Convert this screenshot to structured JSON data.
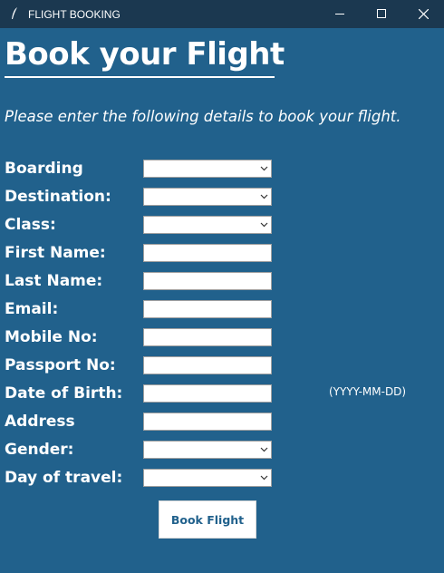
{
  "window": {
    "title": "FLIGHT BOOKING",
    "controls": {
      "minimize": "minimize-icon",
      "maximize": "maximize-icon",
      "close": "close-icon"
    }
  },
  "heading": "Book your Flight",
  "subtitle": "Please enter the following details to book your flight.",
  "form": {
    "boarding": {
      "label": "Boarding",
      "type": "dropdown",
      "value": ""
    },
    "destination": {
      "label": "Destination:",
      "type": "dropdown",
      "value": ""
    },
    "class": {
      "label": "Class:",
      "type": "dropdown",
      "value": ""
    },
    "first_name": {
      "label": "First Name:",
      "type": "text",
      "value": ""
    },
    "last_name": {
      "label": "Last Name:",
      "type": "text",
      "value": ""
    },
    "email": {
      "label": "Email:",
      "type": "text",
      "value": ""
    },
    "mobile": {
      "label": "Mobile No:",
      "type": "text",
      "value": ""
    },
    "passport": {
      "label": "Passport No:",
      "type": "text",
      "value": ""
    },
    "dob": {
      "label": "Date of Birth:",
      "type": "text",
      "value": "",
      "hint": "(YYYY-MM-DD)"
    },
    "address": {
      "label": "Address",
      "type": "text",
      "value": ""
    },
    "gender": {
      "label": "Gender:",
      "type": "dropdown",
      "value": ""
    },
    "travel_day": {
      "label": "Day of travel:",
      "type": "dropdown",
      "value": ""
    }
  },
  "submit_label": "Book Flight",
  "colors": {
    "background": "#21618c",
    "titlebar": "#1b3850",
    "text": "#ffffff",
    "button_text": "#21618c"
  }
}
